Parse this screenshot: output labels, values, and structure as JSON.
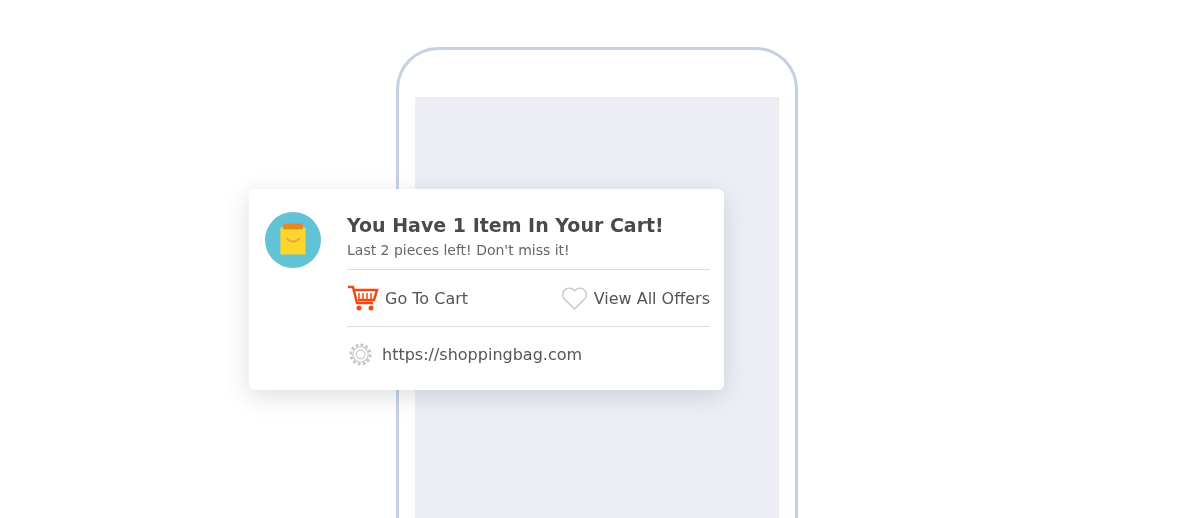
{
  "notification": {
    "title": "You Have 1 Item In Your Cart!",
    "message": "Last 2 pieces left! Don't miss it!",
    "actions": [
      {
        "kind": "cart",
        "label": "Go To Cart"
      },
      {
        "kind": "offers",
        "label": "View All Offers"
      }
    ],
    "site": "https://shoppingbag.com"
  }
}
